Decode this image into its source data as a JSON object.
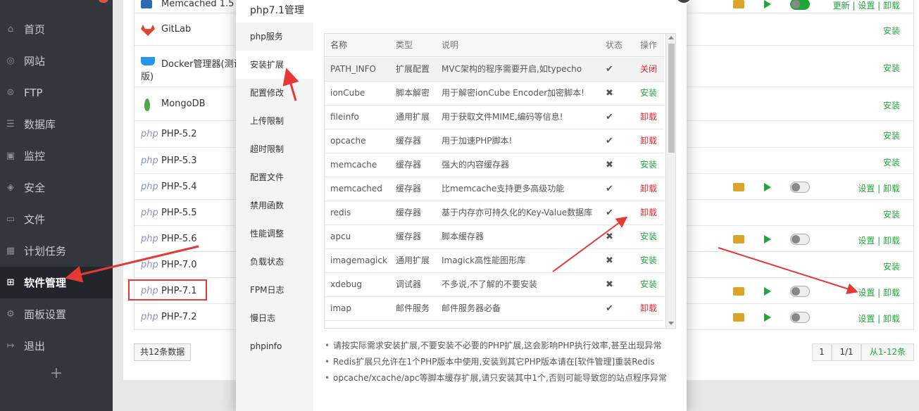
{
  "sidebar": {
    "items": [
      {
        "label": "首页",
        "icon": "home-icon",
        "glyph": "⌂"
      },
      {
        "label": "网站",
        "icon": "globe-icon",
        "glyph": "◎"
      },
      {
        "label": "FTP",
        "icon": "ftp-icon",
        "glyph": "⊜"
      },
      {
        "label": "数据库",
        "icon": "database-icon",
        "glyph": "☰"
      },
      {
        "label": "监控",
        "icon": "monitor-icon",
        "glyph": "▣"
      },
      {
        "label": "安全",
        "icon": "shield-icon",
        "glyph": "◈"
      },
      {
        "label": "文件",
        "icon": "folder-icon",
        "glyph": "▭"
      },
      {
        "label": "计划任务",
        "icon": "calendar-icon",
        "glyph": "▦"
      },
      {
        "label": "软件管理",
        "icon": "apps-icon",
        "glyph": "⊞"
      },
      {
        "label": "面板设置",
        "icon": "gear-icon",
        "glyph": "⚙"
      },
      {
        "label": "退出",
        "icon": "logout-icon",
        "glyph": "↦"
      }
    ],
    "add_label": "+"
  },
  "software": {
    "top_partial": {
      "name": "Memcached 1.5",
      "ops": "更新 | 设置 | 卸载"
    },
    "rows": [
      {
        "logo": "gitlab-icon",
        "name": "GitLab",
        "action": "安装"
      },
      {
        "logo": "docker-icon",
        "name": "Docker管理器(测试",
        "name2": "版)",
        "action": "安装"
      },
      {
        "logo": "mongodb-icon",
        "name": "MongoDB",
        "action": "安装"
      },
      {
        "logo": "php",
        "name": "PHP-5.2",
        "action": "安装"
      },
      {
        "logo": "php",
        "name": "PHP-5.3",
        "action": "安装"
      },
      {
        "logo": "php",
        "name": "PHP-5.4",
        "action": "设置 | 卸载",
        "installed": true
      },
      {
        "logo": "php",
        "name": "PHP-5.5",
        "action": "安装"
      },
      {
        "logo": "php",
        "name": "PHP-5.6",
        "action": "设置 | 卸载",
        "installed": true
      },
      {
        "logo": "php",
        "name": "PHP-7.0",
        "action": "安装"
      },
      {
        "logo": "php",
        "name": "PHP-7.1",
        "action": "设置 | 卸载",
        "installed": true
      },
      {
        "logo": "php",
        "name": "PHP-7.2",
        "action": "设置 | 卸载",
        "installed": true
      }
    ],
    "total": "共12条数据",
    "pager": {
      "page": "1",
      "of": "1/1",
      "range": "从1-12条"
    }
  },
  "modal": {
    "title": "php7.1管理",
    "menu": [
      "php服务",
      "安装扩展",
      "配置修改",
      "上传限制",
      "超时限制",
      "配置文件",
      "禁用函数",
      "性能调整",
      "负载状态",
      "FPM日志",
      "慢日志",
      "phpinfo"
    ],
    "active_menu": 1,
    "table": {
      "headers": {
        "name": "名称",
        "type": "类型",
        "desc": "说明",
        "status": "状态",
        "op": "操作"
      },
      "rows": [
        {
          "name": "PATH_INFO",
          "type": "扩展配置",
          "desc": "MVC架构的程序需要开启,如typecho",
          "status": "✔",
          "op": "关闭",
          "op_color": "red"
        },
        {
          "name": "ionCube",
          "type": "脚本解密",
          "desc": "用于解密ionCube Encoder加密脚本!",
          "status": "✖",
          "op": "安装",
          "op_color": "green"
        },
        {
          "name": "fileinfo",
          "type": "通用扩展",
          "desc": "用于获取文件MIME,编码等信息!",
          "status": "✔",
          "op": "卸载",
          "op_color": "red"
        },
        {
          "name": "opcache",
          "type": "缓存器",
          "desc": "用于加速PHP脚本!",
          "status": "✔",
          "op": "卸载",
          "op_color": "red"
        },
        {
          "name": "memcache",
          "type": "缓存器",
          "desc": "强大的内容缓存器",
          "status": "✖",
          "op": "安装",
          "op_color": "green"
        },
        {
          "name": "memcached",
          "type": "缓存器",
          "desc": "比memcache支持更多高级功能",
          "status": "✔",
          "op": "卸载",
          "op_color": "red"
        },
        {
          "name": "redis",
          "type": "缓存器",
          "desc": "基于内存亦可持久化的Key-Value数据库",
          "status": "✔",
          "op": "卸载",
          "op_color": "red"
        },
        {
          "name": "apcu",
          "type": "缓存器",
          "desc": "脚本缓存器",
          "status": "✖",
          "op": "安装",
          "op_color": "green"
        },
        {
          "name": "imagemagick",
          "type": "通用扩展",
          "desc": "Imagick高性能图形库",
          "status": "✖",
          "op": "安装",
          "op_color": "green"
        },
        {
          "name": "xdebug",
          "type": "调试器",
          "desc": "不多说,不了解的不要安装",
          "status": "✖",
          "op": "安装",
          "op_color": "green"
        },
        {
          "name": "imap",
          "type": "邮件服务",
          "desc": "邮件服务器必备",
          "status": "✔",
          "op": "卸载",
          "op_color": "red"
        }
      ]
    },
    "notes": [
      "请按实际需求安装扩展,不要安装不必要的PHP扩展,这会影响PHP执行效率,甚至出现异常",
      "Redis扩展只允许在1个PHP版本中使用,安装到其它PHP版本请在[软件管理]重装Redis",
      "opcache/xcache/apc等脚本缓存扩展,请只安装其中1个,否则可能导致您的站点程序异常"
    ]
  },
  "colors": {
    "accent_green": "#20a53a",
    "danger_red": "#e0282a",
    "arrow_red": "#e53935"
  }
}
